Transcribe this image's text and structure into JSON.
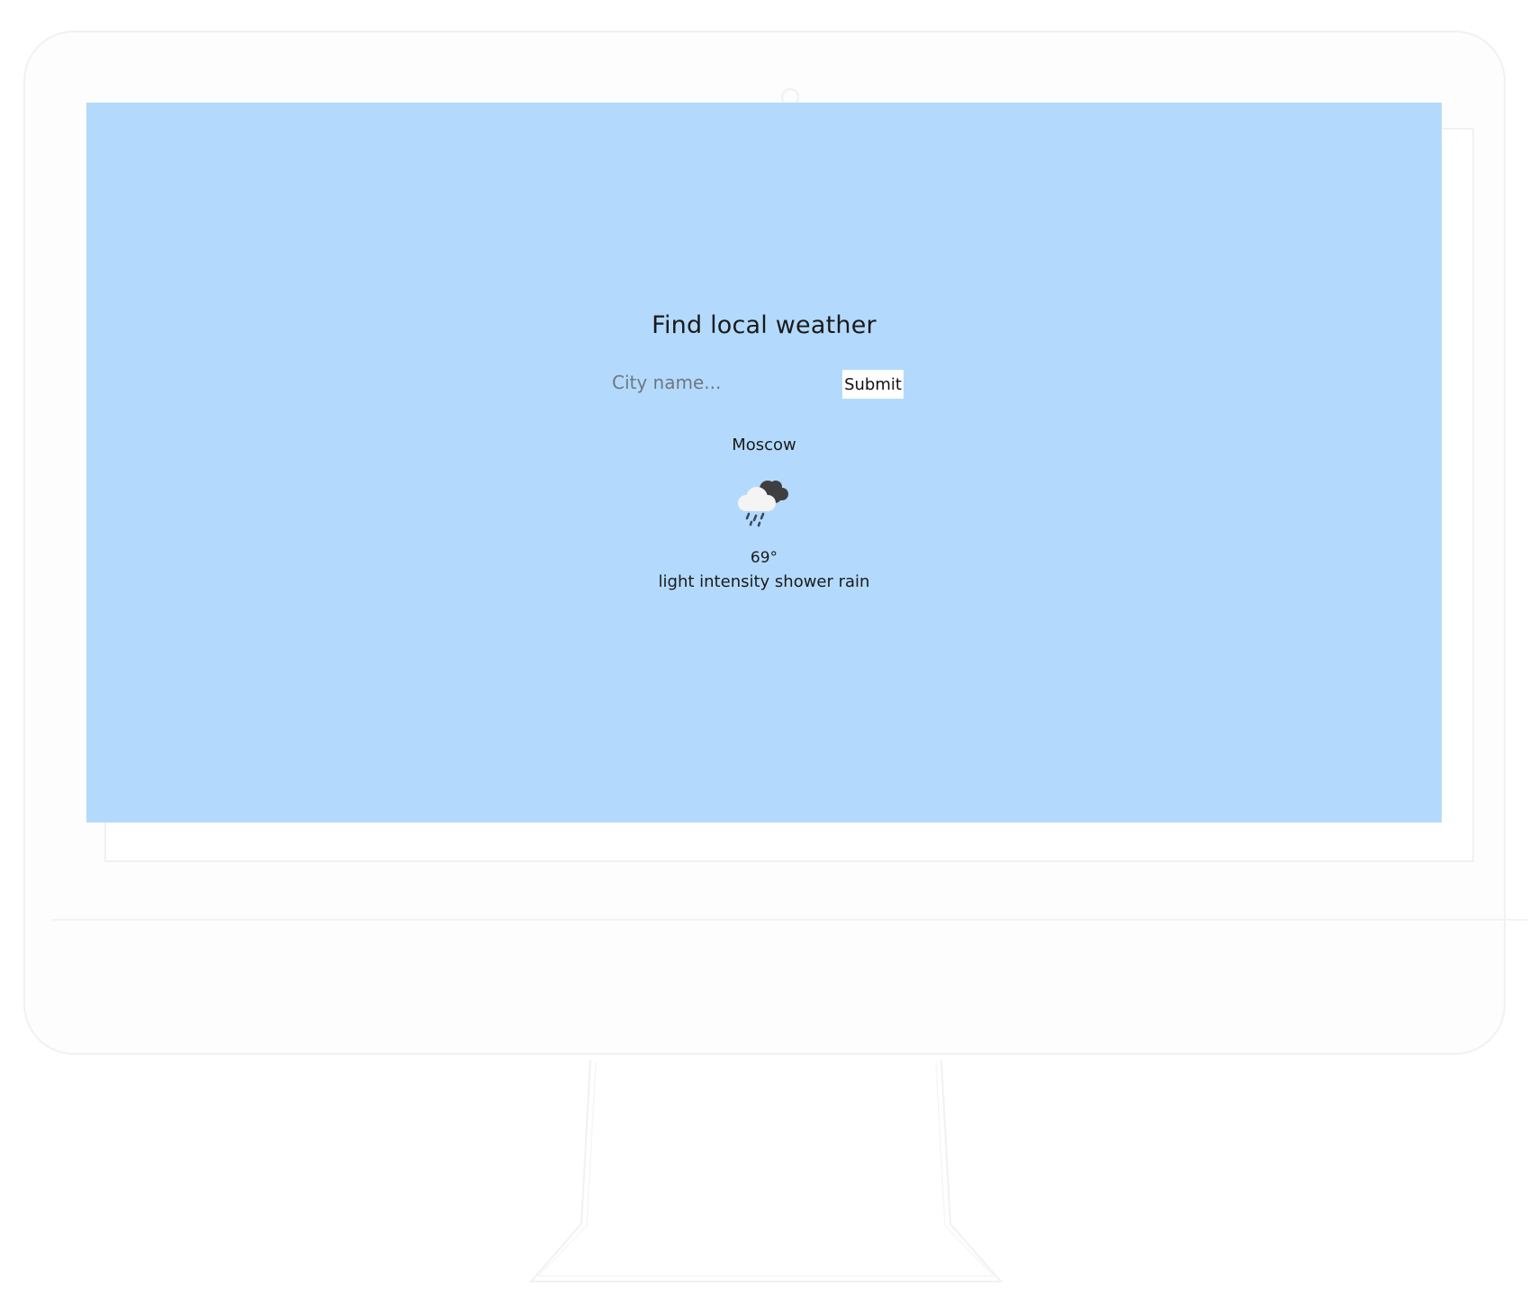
{
  "app": {
    "title": "Find local weather"
  },
  "search": {
    "placeholder": "City name...",
    "value": "",
    "submit_label": "Submit"
  },
  "result": {
    "city": "Moscow",
    "icon": "rain-cloud-icon",
    "temperature": "69°",
    "description": "light intensity shower rain"
  },
  "colors": {
    "screen_background": "#b3dafc",
    "button_background": "#ffffff",
    "text": "#1a1a1a"
  }
}
